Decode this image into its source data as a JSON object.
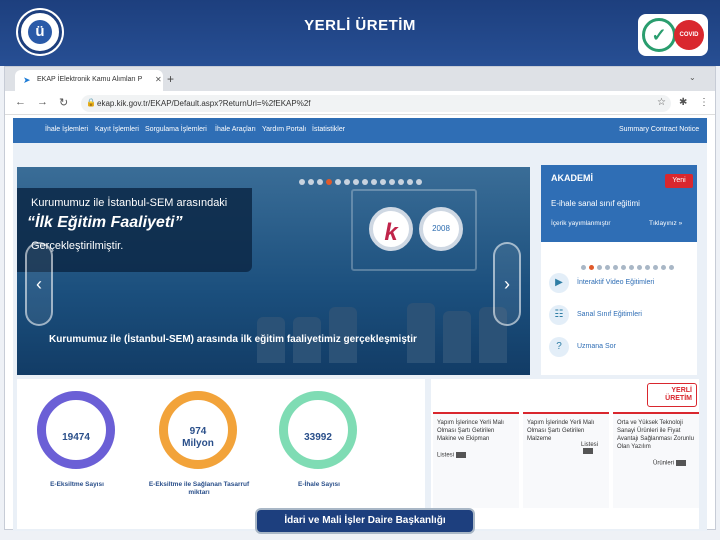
{
  "slide": {
    "title": "YERLİ ÜRETİM"
  },
  "footer": {
    "text": "İdari ve Mali İşler Daire Başkanlığı"
  },
  "browser": {
    "tab_title": "EKAP İElektronik Kamu Alımları P",
    "url": "ekap.kik.gov.tr/EKAP/Default.aspx?ReturnUrl=%2fEKAP%2f"
  },
  "site_nav": {
    "items": [
      "İhale İşlemleri",
      "Kayıt İşlemleri",
      "Sorgulama İşlemleri",
      "İhale Araçları",
      "Yardım Portalı",
      "İstatistikler"
    ],
    "right_item": "Summary Contract Notice"
  },
  "hero": {
    "line1": "Kurumumuz ile İstanbul-SEM arasındaki",
    "line2": "“İlk Eğitim Faaliyeti”",
    "line3": "Gerçekleştirilmiştir.",
    "caption": "Kurumumuz ile (İstanbul-SEM) arasında ilk eğitim faaliyetimiz gerçekleşmiştir",
    "seal_year": "2008",
    "total_slides": 14,
    "active_slide": 3
  },
  "akademi": {
    "logo": "AKADEMİ",
    "badge": "Yeni",
    "title": "E-ihale sanal sınıf eğitimi",
    "subtitle": "İçerik yayımlanmıştır",
    "link": "Tıklayınız »",
    "items": [
      {
        "label": "İnteraktif Video Eğitimleri",
        "icon": "play-icon"
      },
      {
        "label": "Sanal Sınıf Eğitimleri",
        "icon": "classroom-icon"
      },
      {
        "label": "Uzmana Sor",
        "icon": "question-icon"
      }
    ]
  },
  "stats": [
    {
      "value": "19474",
      "unit": "",
      "label": "E-Eksiltme Sayısı",
      "color": "#6b5fd6"
    },
    {
      "value": "974",
      "unit": "Milyon",
      "label": "E-Eksiltme ile Sağlanan Tasarruf miktarı",
      "color": "#f2a33a"
    },
    {
      "value": "33992",
      "unit": "",
      "label": "E-İhale Sayısı",
      "color": "#7fdcb4"
    }
  ],
  "yerli": {
    "logo": "YERLİ ÜRETİM",
    "cards": [
      {
        "text": "Yapım İşlerince Yerli Malı Olması Şartı Getirilen Makine ve Ekipman",
        "link": "Listesi"
      },
      {
        "text": "Yapım İşlerinde Yerli Malı Olması Şartı Getirilen Malzeme",
        "link": "Listesi"
      },
      {
        "text": "Orta ve Yüksek Teknoloji Sanayi Ürünleri ile Fiyat Avantajı Sağlanması Zorunlu Olan Yazılım",
        "link": "Ürünleri"
      }
    ]
  }
}
